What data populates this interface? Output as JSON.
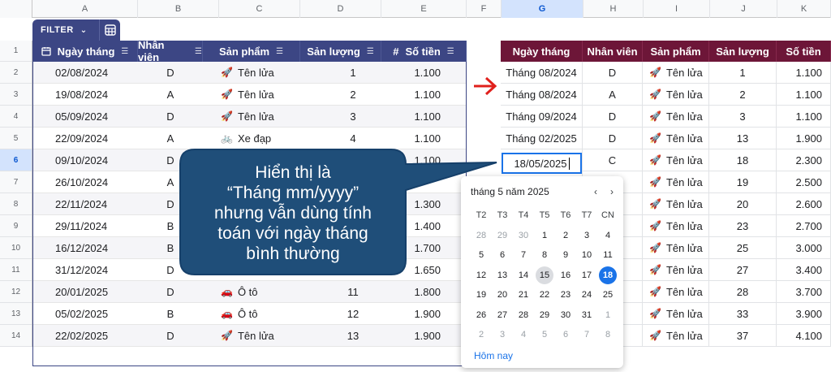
{
  "column_headers": [
    "A",
    "B",
    "C",
    "D",
    "E",
    "F",
    "G",
    "H",
    "I",
    "J",
    "K"
  ],
  "row_headers": [
    "1",
    "2",
    "3",
    "4",
    "5",
    "6",
    "7",
    "8",
    "9",
    "10",
    "11",
    "12",
    "13",
    "14"
  ],
  "filter_chip": {
    "label": "FILTER"
  },
  "left_table": {
    "headers": [
      "Ngày tháng",
      "Nhân viên",
      "Sản phẩm",
      "Sản lượng",
      "Số tiền"
    ],
    "rows": [
      {
        "date": "02/08/2024",
        "staff": "D",
        "icon": "🚀",
        "product": "Tên lửa",
        "qty": "1",
        "amount": "1.100"
      },
      {
        "date": "19/08/2024",
        "staff": "A",
        "icon": "🚀",
        "product": "Tên lửa",
        "qty": "2",
        "amount": "1.100"
      },
      {
        "date": "05/09/2024",
        "staff": "D",
        "icon": "🚀",
        "product": "Tên lửa",
        "qty": "3",
        "amount": "1.100"
      },
      {
        "date": "22/09/2024",
        "staff": "A",
        "icon": "🚲",
        "product": "Xe đạp",
        "qty": "4",
        "amount": "1.100"
      },
      {
        "date": "09/10/2024",
        "staff": "D",
        "icon": "",
        "product": "",
        "qty": "",
        "amount": "1.100"
      },
      {
        "date": "26/10/2024",
        "staff": "A",
        "icon": "",
        "product": "",
        "qty": "",
        "amount": ""
      },
      {
        "date": "22/11/2024",
        "staff": "D",
        "icon": "",
        "product": "",
        "qty": "",
        "amount": "1.300"
      },
      {
        "date": "29/11/2024",
        "staff": "B",
        "icon": "",
        "product": "",
        "qty": "",
        "amount": "1.400"
      },
      {
        "date": "16/12/2024",
        "staff": "B",
        "icon": "",
        "product": "",
        "qty": "",
        "amount": "1.700"
      },
      {
        "date": "31/12/2024",
        "staff": "D",
        "icon": "🚗",
        "product": "Ô tô",
        "qty": "10",
        "amount": "1.650"
      },
      {
        "date": "20/01/2025",
        "staff": "D",
        "icon": "🚗",
        "product": "Ô tô",
        "qty": "11",
        "amount": "1.800"
      },
      {
        "date": "05/02/2025",
        "staff": "B",
        "icon": "🚗",
        "product": "Ô tô",
        "qty": "12",
        "amount": "1.900"
      },
      {
        "date": "22/02/2025",
        "staff": "D",
        "icon": "🚀",
        "product": "Tên lửa",
        "qty": "13",
        "amount": "1.900"
      }
    ]
  },
  "right_table": {
    "headers": [
      "Ngày tháng",
      "Nhân viên",
      "Sản phẩm",
      "Sản lượng",
      "Số tiền"
    ],
    "rows": [
      {
        "date": "Tháng 08/2024",
        "staff": "D",
        "icon": "🚀",
        "product": "Tên lửa",
        "qty": "1",
        "amount": "1.100"
      },
      {
        "date": "Tháng 08/2024",
        "staff": "A",
        "icon": "🚀",
        "product": "Tên lửa",
        "qty": "2",
        "amount": "1.100"
      },
      {
        "date": "Tháng 09/2024",
        "staff": "D",
        "icon": "🚀",
        "product": "Tên lửa",
        "qty": "3",
        "amount": "1.100"
      },
      {
        "date": "Tháng 02/2025",
        "staff": "D",
        "icon": "🚀",
        "product": "Tên lửa",
        "qty": "13",
        "amount": "1.900"
      },
      {
        "date": "",
        "staff": "C",
        "icon": "🚀",
        "product": "Tên lửa",
        "qty": "18",
        "amount": "2.300"
      },
      {
        "date": "",
        "staff": "",
        "icon": "🚀",
        "product": "Tên lửa",
        "qty": "19",
        "amount": "2.500"
      },
      {
        "date": "",
        "staff": "",
        "icon": "🚀",
        "product": "Tên lửa",
        "qty": "20",
        "amount": "2.600"
      },
      {
        "date": "",
        "staff": "",
        "icon": "🚀",
        "product": "Tên lửa",
        "qty": "23",
        "amount": "2.700"
      },
      {
        "date": "",
        "staff": "",
        "icon": "🚀",
        "product": "Tên lửa",
        "qty": "25",
        "amount": "3.000"
      },
      {
        "date": "",
        "staff": "",
        "icon": "🚀",
        "product": "Tên lửa",
        "qty": "27",
        "amount": "3.400"
      },
      {
        "date": "",
        "staff": "",
        "icon": "🚀",
        "product": "Tên lửa",
        "qty": "28",
        "amount": "3.700"
      },
      {
        "date": "",
        "staff": "",
        "icon": "🚀",
        "product": "Tên lửa",
        "qty": "33",
        "amount": "3.900"
      },
      {
        "date": "",
        "staff": "",
        "icon": "🚀",
        "product": "Tên lửa",
        "qty": "37",
        "amount": "4.100"
      }
    ]
  },
  "active_cell": {
    "value": "18/05/2025"
  },
  "callout": {
    "lines": [
      "Hiển thị là",
      "“Tháng mm/yyyy”",
      "nhưng vẫn dùng tính",
      "toán với ngày tháng",
      "bình thường"
    ]
  },
  "date_picker": {
    "month_label": "tháng 5 năm 2025",
    "weekdays": [
      "T2",
      "T3",
      "T4",
      "T5",
      "T6",
      "T7",
      "CN"
    ],
    "weeks": [
      [
        "28",
        "29",
        "30",
        "1",
        "2",
        "3",
        "4"
      ],
      [
        "5",
        "6",
        "7",
        "8",
        "9",
        "10",
        "11"
      ],
      [
        "12",
        "13",
        "14",
        "15",
        "16",
        "17",
        "18"
      ],
      [
        "19",
        "20",
        "21",
        "22",
        "23",
        "24",
        "25"
      ],
      [
        "26",
        "27",
        "28",
        "29",
        "30",
        "31",
        "1"
      ],
      [
        "2",
        "3",
        "4",
        "5",
        "6",
        "7",
        "8"
      ]
    ],
    "today_label": "Hôm nay",
    "today_day": "15",
    "selected_day": "18"
  },
  "colors": {
    "left_header": "#3c4684",
    "right_header": "#6d1638",
    "callout": "#1f4e79",
    "arrow": "#e0201c",
    "selected": "#1a73e8"
  }
}
